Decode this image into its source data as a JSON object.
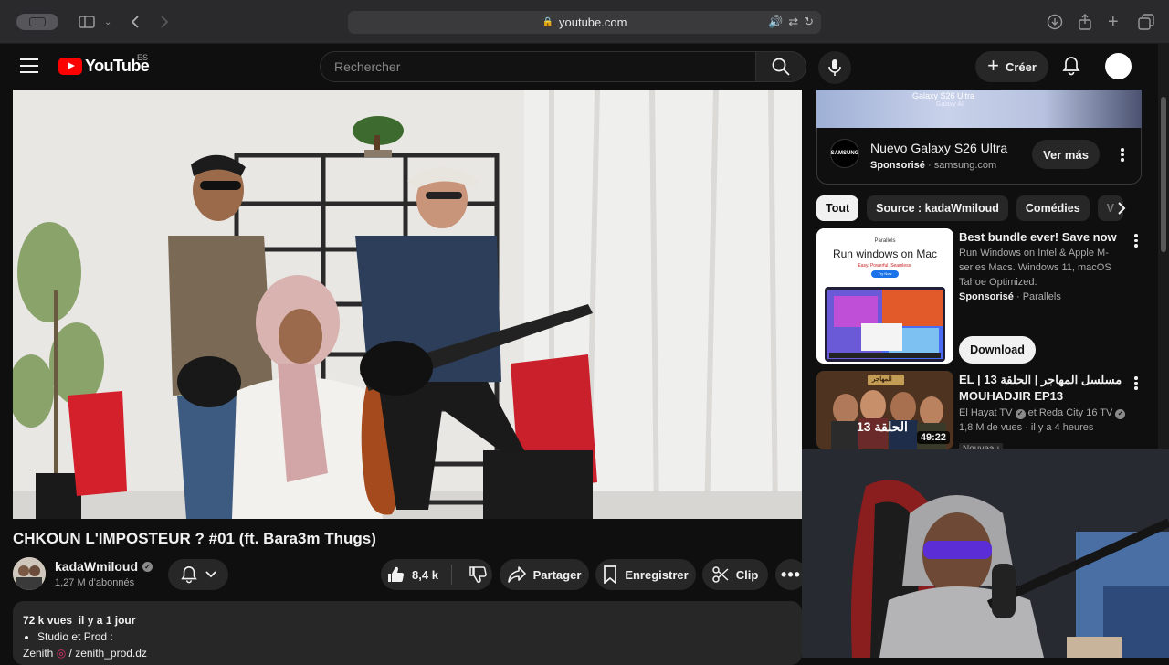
{
  "browser": {
    "url": "youtube.com",
    "icons": [
      "sidebar-icon",
      "back-icon",
      "forward-icon",
      "lock-icon",
      "audio-icon",
      "translate-icon",
      "reload-icon",
      "download-icon",
      "share-icon",
      "new-tab-icon",
      "tabs-icon"
    ]
  },
  "header": {
    "logo_text": "YouTube",
    "country_code": "ES",
    "search_placeholder": "Rechercher",
    "create_label": "Créer"
  },
  "video": {
    "title": "CHKOUN L'IMPOSTEUR ? #01 (ft. Bara3m Thugs)",
    "channel": "kadaWmiloud",
    "subscribers": "1,27 M d'abonnés",
    "likes": "8,4 k",
    "share_label": "Partager",
    "save_label": "Enregistrer",
    "clip_label": "Clip",
    "description": {
      "stats": "72 k vues",
      "age": "il y a 1 jour",
      "bullet": "Studio et Prod :",
      "line3_prefix": "Zenith",
      "line3_link": "/ zenith_prod.dz"
    }
  },
  "sidebar": {
    "ad": {
      "banner_title": "Galaxy S26 Ultra",
      "banner_sub": "Galaxy AI",
      "logo_text": "SAMSUNG",
      "title": "Nuevo Galaxy S26 Ultra",
      "sponsored": "Sponsorisé",
      "domain": "samsung.com",
      "cta": "Ver más"
    },
    "chips": [
      "Tout",
      "Source : kadaWmiloud",
      "Comédies",
      "V"
    ],
    "cards": [
      {
        "title": "Best bundle ever! Save now",
        "desc": "Run Windows on Intel & Apple M-series Macs. Windows 11, macOS Tahoe Optimized.",
        "sponsored": "Sponsorisé",
        "advertiser": "Parallels",
        "cta": "Download",
        "thumb_brand": "Parallels",
        "thumb_title": "Run windows on Mac",
        "thumb_tagline": "Easy. Powerful. Seamless.",
        "thumb_button": "Try Now"
      },
      {
        "title": "EL | 13 مسلسل المهاجر | الحلقة MOUHADJIR EP13",
        "channel": "El Hayat TV",
        "collab": "et Reda City 16 TV",
        "views": "1,8 M de vues",
        "age": "il y a 4 heures",
        "badge": "Nouveau",
        "duration": "49:22",
        "thumb_label": "الحلقة 13",
        "thumb_logo": "المهاجر"
      }
    ]
  },
  "colors": {
    "background": "#0f0f0f",
    "surface": "#272727",
    "brand_red": "#ff0000",
    "text": "#f1f1f1",
    "muted": "#aaaaaa"
  }
}
